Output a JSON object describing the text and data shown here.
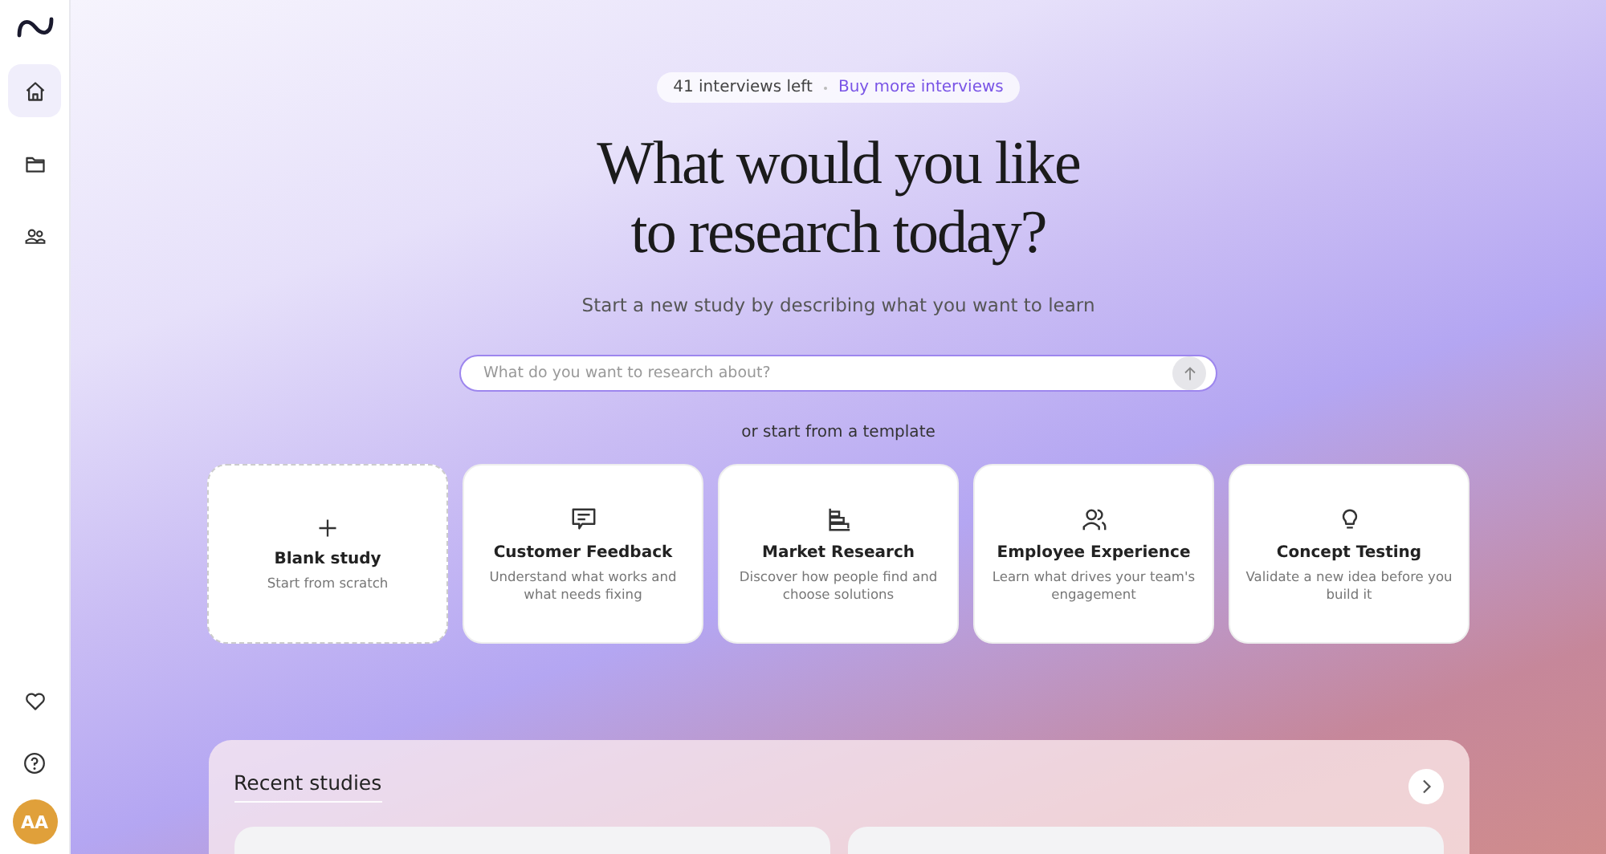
{
  "sidebar": {
    "nav": [
      {
        "selected": true
      },
      {
        "selected": false
      },
      {
        "selected": false
      }
    ],
    "avatar": "AA"
  },
  "credits": {
    "remaining": "41 interviews left",
    "link": "Buy more interviews"
  },
  "headline": [
    "What would you like",
    "to research today?"
  ],
  "subtitle": "Start a new study by describing what you want to learn",
  "prompt": {
    "placeholder": "What do you want to research about?"
  },
  "template_label": "or start from a template",
  "templates": [
    {
      "kind": "blank",
      "title": "Blank study",
      "description": "Start from scratch"
    },
    {
      "kind": "template",
      "title": "Customer Feedback",
      "description": "Understand what works and what needs fixing"
    },
    {
      "kind": "template",
      "title": "Market Research",
      "description": "Discover how people find and choose solutions"
    },
    {
      "kind": "template",
      "title": "Employee Experience",
      "description": "Learn what drives your team's engagement"
    },
    {
      "kind": "template",
      "title": "Concept Testing",
      "description": "Validate a new idea before you build it"
    }
  ],
  "recent": {
    "title": "Recent studies"
  }
}
